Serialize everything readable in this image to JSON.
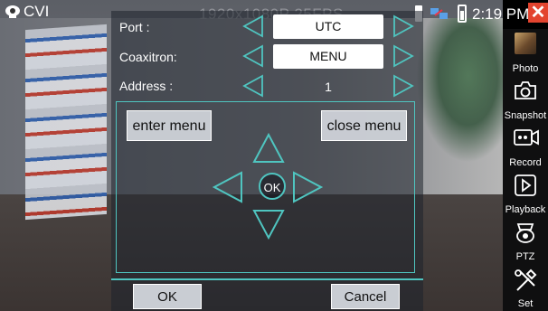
{
  "app": {
    "title": "CVI",
    "resolution": "1920x1080P 25FPS",
    "time": "2:19 PM"
  },
  "dialog": {
    "rows": [
      {
        "label": "Port :",
        "value": "UTC"
      },
      {
        "label": "Coaxitron:",
        "value": "MENU"
      },
      {
        "label": "Address :",
        "value": "1"
      }
    ],
    "enter_menu": "enter menu",
    "close_menu": "close menu",
    "ok_center": "OK",
    "ok_button": "OK",
    "cancel_button": "Cancel"
  },
  "sidebar": {
    "items": [
      {
        "label": "Photo",
        "icon": "photo-icon"
      },
      {
        "label": "Snapshot",
        "icon": "camera-icon"
      },
      {
        "label": "Record",
        "icon": "record-icon"
      },
      {
        "label": "Playback",
        "icon": "play-icon"
      },
      {
        "label": "PTZ",
        "icon": "ptz-icon"
      },
      {
        "label": "Set",
        "icon": "tools-icon"
      }
    ]
  },
  "colors": {
    "accent": "#4fc5c0",
    "close": "#e3442f",
    "sidebar": "#0f0f10"
  }
}
